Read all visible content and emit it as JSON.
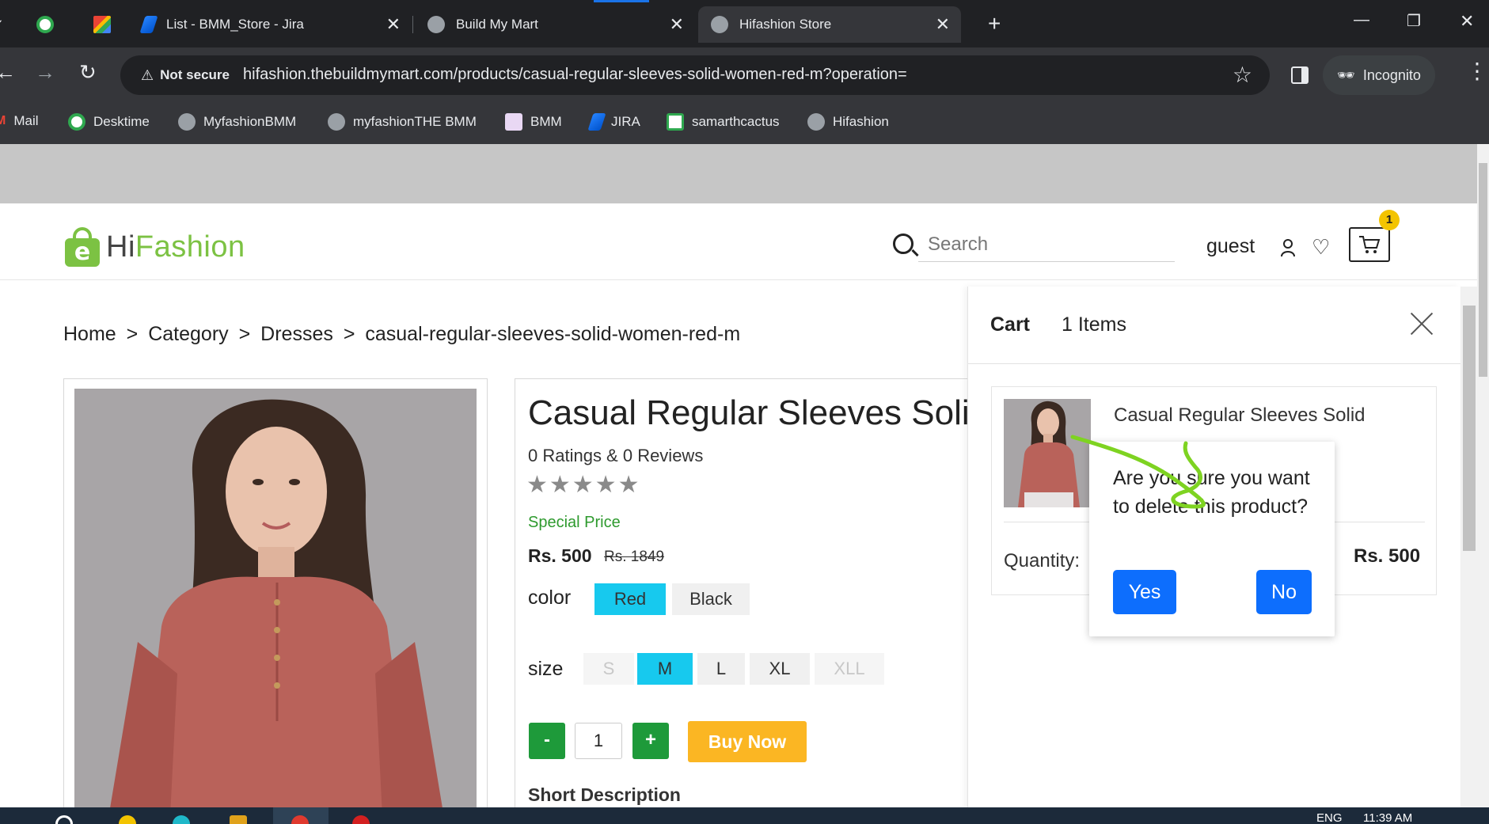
{
  "browser": {
    "tabs": [
      {
        "label": ""
      },
      {
        "label": ""
      },
      {
        "label": "List - BMM_Store - Jira"
      },
      {
        "label": "Build My Mart"
      },
      {
        "label": "Hifashion Store"
      }
    ],
    "security_label": "Not secure",
    "url": "hifashion.thebuildmymart.com/products/casual-regular-sleeves-solid-women-red-m?operation=",
    "profile_label": "Incognito",
    "bookmarks": [
      "Mail",
      "Desktime",
      "MyfashionBMM",
      "myfashionTHE BMM",
      "BMM",
      "JIRA",
      "samarthcactus",
      "Hifashion"
    ]
  },
  "header": {
    "logo_prefix": "Hi",
    "logo_suffix": "Fashion",
    "search_placeholder": "Search",
    "username": "guest",
    "cart_count": "1"
  },
  "breadcrumb": {
    "items": [
      "Home",
      "Category",
      "Dresses",
      "casual-regular-sleeves-solid-women-red-m"
    ],
    "separator": ">"
  },
  "product": {
    "title": "Casual Regular Sleeves Solid Women Red M",
    "ratings_text": "0 Ratings & 0 Reviews",
    "stars": "★★★★★",
    "special_label": "Special Price",
    "price": "Rs. 500",
    "old_price": "Rs. 1849",
    "color_label": "color",
    "colors": [
      "Red",
      "Black"
    ],
    "size_label": "size",
    "sizes": [
      "S",
      "M",
      "L",
      "XL",
      "XLL"
    ],
    "quantity": "1",
    "minus_label": "-",
    "plus_label": "+",
    "buy_now_label": "Buy Now",
    "short_description_label": "Short Description"
  },
  "cart": {
    "title": "Cart",
    "items_count_label": "1 Items",
    "item_name": "Casual Regular Sleeves Solid",
    "quantity_label": "Quantity:",
    "item_price": "Rs. 500"
  },
  "confirm_dialog": {
    "message": "Are you sure you want to delete this product?",
    "yes_label": "Yes",
    "no_label": "No"
  },
  "taskbar": {
    "language": "ENG",
    "time": "11:39 AM"
  },
  "colors": {
    "brand_green": "#7cc243",
    "selected_chip": "#17c9ee",
    "qty_button": "#1e9a3a",
    "buy_now": "#fbb623",
    "dialog_button": "#0d6efd",
    "special_price": "#2e9a2e",
    "badge": "#f3c400",
    "annotation_stroke": "#7ed321"
  }
}
